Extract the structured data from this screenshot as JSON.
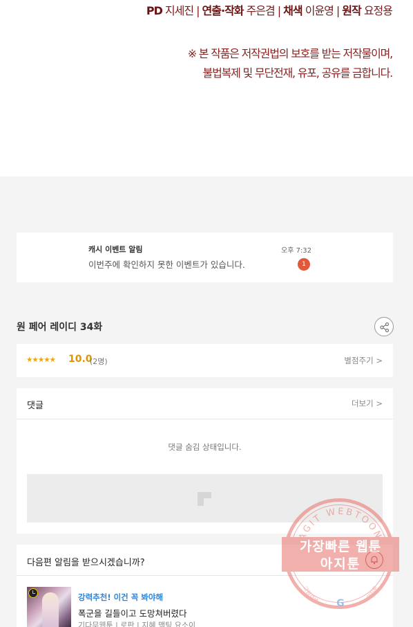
{
  "credits": {
    "pd_label": "PD",
    "pd_name": "지세진",
    "direction_label": "연출·작화",
    "direction_name": "주은겸",
    "color_label": "채색",
    "color_name": "이윤영",
    "original_label": "원작",
    "original_name": "요정용",
    "separator": "|",
    "copyright_line1": "※ 본 작품은 저작권법의 보호를 받는 저작물이며,",
    "copyright_line2": "불법복제 및 무단전재, 유포, 공유를 금합니다."
  },
  "notification": {
    "title": "캐시 이벤트 알림",
    "time": "오후 7:32",
    "body": "이번주에 확인하지 못한 이벤트가 있습니다.",
    "badge": "1"
  },
  "episode": {
    "title": "원 페어 레이디 34화",
    "share_icon": "share-icon"
  },
  "rating": {
    "stars": "★★★★★",
    "score": "10.0",
    "count": "(2명)",
    "rate_link": "별점주기 >"
  },
  "comments": {
    "title": "댓글",
    "more_link": "더보기 >",
    "hidden_message": "댓글 숨김 상태입니다."
  },
  "next_alert": {
    "title": "다음편 알림을 받으시겠습니까?",
    "bell_icon": "bell-icon"
  },
  "recommendation": {
    "label": "강력추천! 이건 꼭 봐야해",
    "title": "폭군을 길들이고 도망쳐버렸다",
    "meta": "기다무웹툰 | 로판 | 지혜 맥팅 요소이"
  },
  "watermark": {
    "arc_text": "AGIT WEBTOON",
    "line1": "가장빠른 웹툰",
    "line2": "아지툰",
    "bottom_left": "그림검색",
    "bottom_right": "아지툰"
  },
  "colors": {
    "credit_text": "#7a1a1a",
    "badge": "#e05a3a",
    "score": "#e09500",
    "recommend": "#2f84d8",
    "watermark": "#e8716b"
  }
}
